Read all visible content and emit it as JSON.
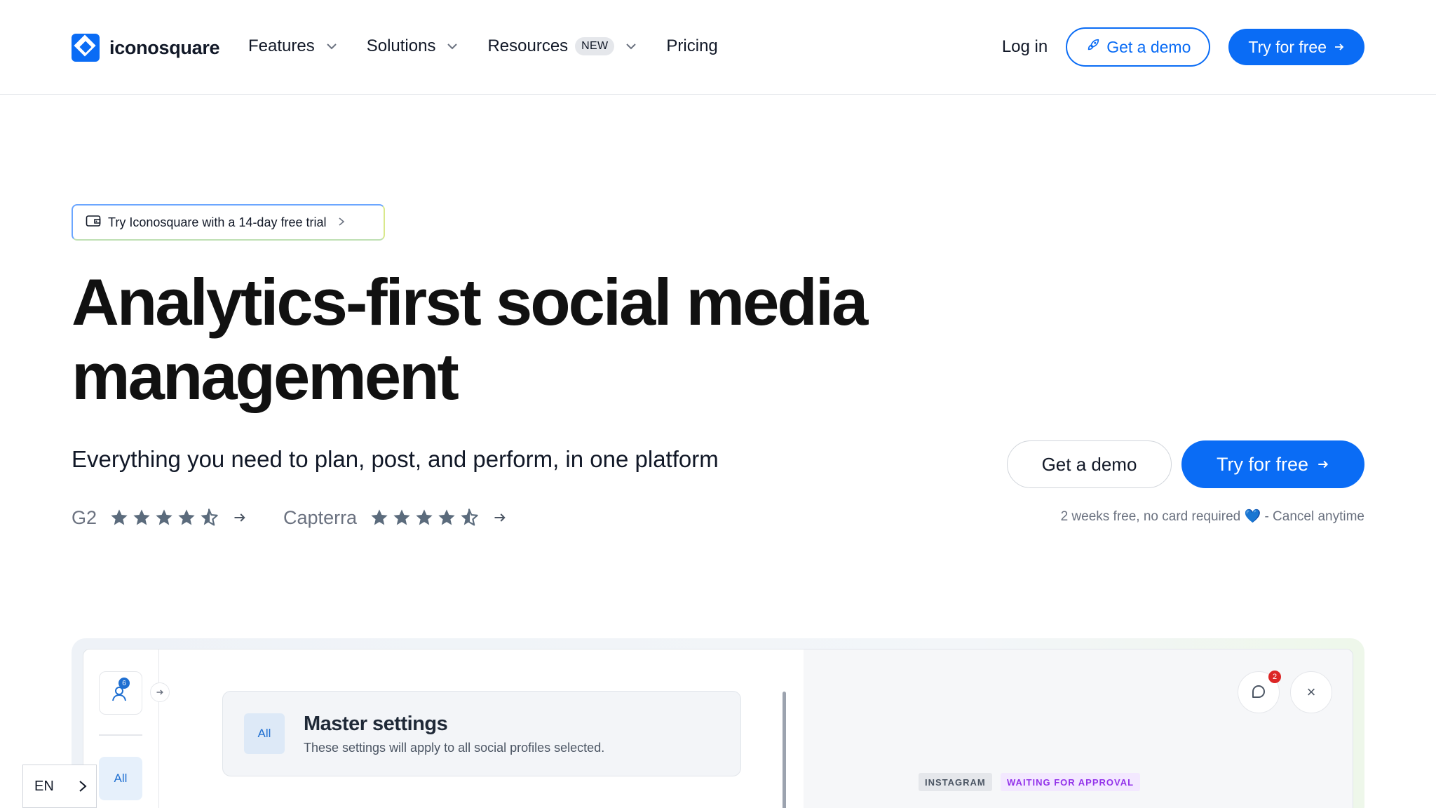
{
  "nav": {
    "logo_text": "iconosquare",
    "menu": [
      {
        "label": "Features",
        "has_dropdown": true
      },
      {
        "label": "Solutions",
        "has_dropdown": true
      },
      {
        "label": "Resources",
        "badge": "NEW",
        "has_dropdown": true
      },
      {
        "label": "Pricing",
        "has_dropdown": false
      }
    ],
    "login_label": "Log in",
    "demo_label": "Get a demo",
    "try_label": "Try for free",
    "brand_color": "#0a6cf5"
  },
  "hero": {
    "trial_pill": "Try Iconosquare with a 14-day free trial",
    "headline": "Analytics-first social media management",
    "subhead": "Everything you need to plan, post, and perform, in one platform",
    "ratings": [
      {
        "name": "G2",
        "stars": 4.5
      },
      {
        "name": "Capterra",
        "stars": 4.5
      }
    ],
    "cta_demo": "Get a demo",
    "cta_try": "Try for free",
    "cta_note_before": "2 weeks free, no card required",
    "cta_note_heart": "💙",
    "cta_note_after": "- Cancel anytime"
  },
  "preview": {
    "profile_count": "6",
    "sidebar_all": "All",
    "card_all": "All",
    "card_title": "Master settings",
    "card_desc": "These settings will apply to all social profiles selected.",
    "chat_badge": "2",
    "close_symbol": "×",
    "tag_network": "INSTAGRAM",
    "tag_status": "WAITING FOR APPROVAL"
  },
  "language": {
    "current": "EN"
  }
}
